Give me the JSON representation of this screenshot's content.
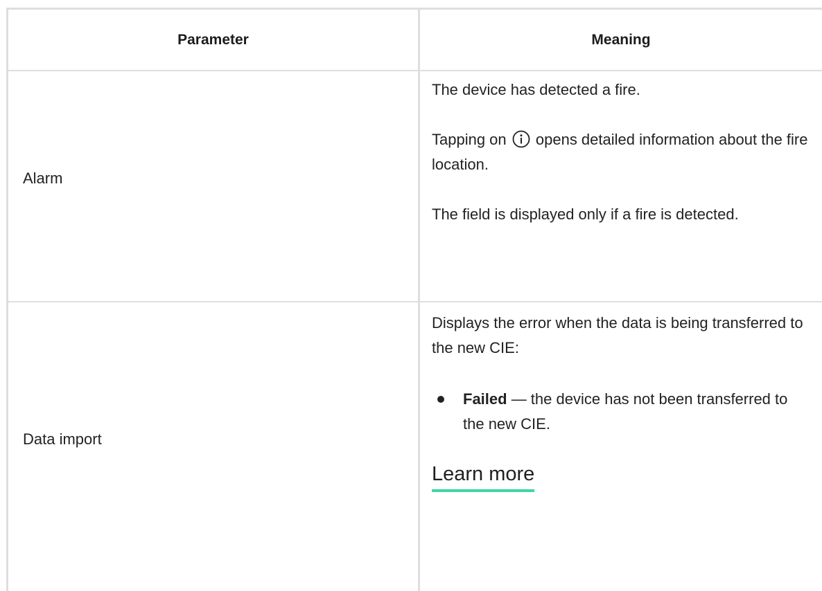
{
  "table": {
    "headers": {
      "parameter": "Parameter",
      "meaning": "Meaning"
    },
    "rows": [
      {
        "parameter": "Alarm",
        "meaning": {
          "p1": "The device has detected a fire.",
          "p2_before_icon": "Tapping on ",
          "p2_icon": "info-icon",
          "p2_after_icon": " opens detailed information about the fire location.",
          "p3": "The field is displayed only if a fire is detected."
        }
      },
      {
        "parameter": "Data import",
        "meaning": {
          "p1": "Displays the error when the data is being transferred to the new CIE:",
          "bullets": [
            {
              "term": "Failed",
              "text": " — the device has not been transferred to the new CIE."
            }
          ],
          "link": "Learn more"
        }
      }
    ]
  },
  "colors": {
    "grid_line": "#dedede",
    "link_underline": "#3fd6a0",
    "text": "#222222"
  }
}
